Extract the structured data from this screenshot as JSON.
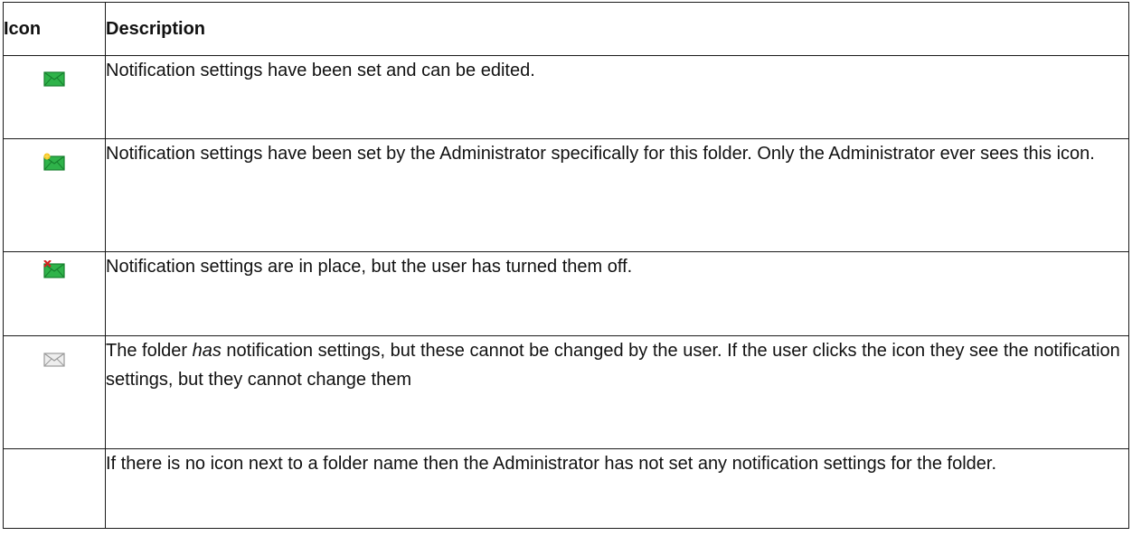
{
  "table": {
    "headers": {
      "icon": "Icon",
      "description": "Description"
    },
    "rows": [
      {
        "icon": "green-envelope-icon",
        "description": "Notification settings have been set and can be edited."
      },
      {
        "icon": "green-envelope-star-icon",
        "description": "Notification settings have been set by the Administrator specifically for this folder.  Only the Administrator ever sees this icon."
      },
      {
        "icon": "green-envelope-x-icon",
        "description": "Notification settings are in place, but the user has turned them off."
      },
      {
        "icon": "grey-envelope-icon",
        "description_pre": "The folder ",
        "description_em": "has",
        "description_post": " notification settings, but these cannot be changed by the user. If the user clicks the icon they see the notification settings, but they cannot change them"
      },
      {
        "icon": "",
        "description": "If there is no icon next to a folder name then the Administrator has not set any notification settings for the folder."
      }
    ]
  },
  "colors": {
    "envelope_green": "#2fb34a",
    "envelope_green_dark": "#17802e",
    "envelope_grey": "#eeeeee",
    "envelope_grey_border": "#9a9a9a",
    "star": "#f6c21d",
    "x_mark": "#d42020"
  }
}
